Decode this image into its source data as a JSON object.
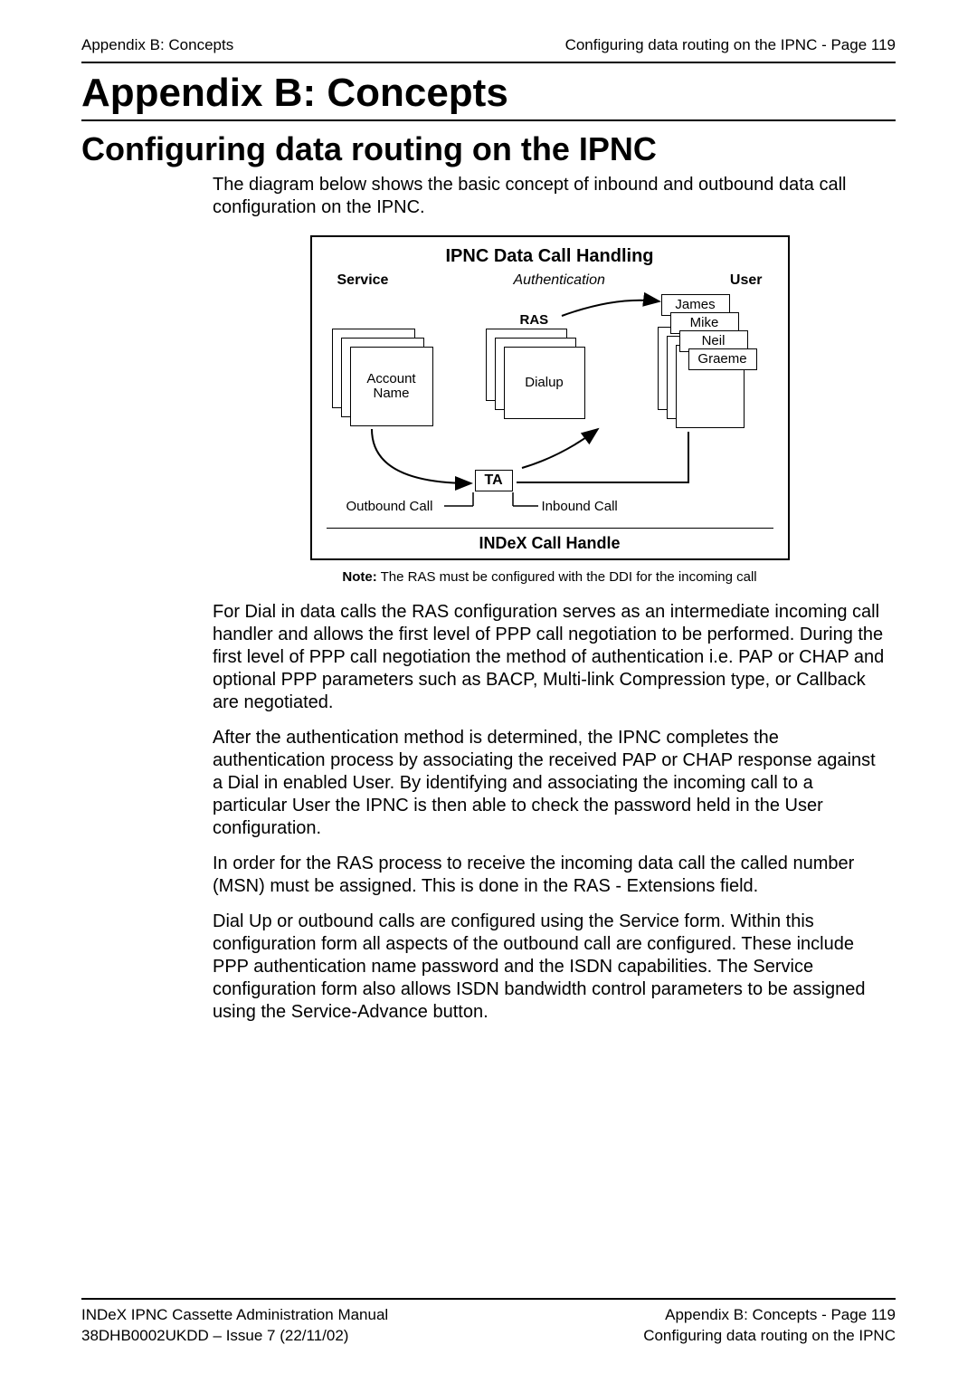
{
  "header": {
    "left": "Appendix B: Concepts",
    "right": "Configuring data routing on the IPNC - Page 119"
  },
  "title": "Appendix B: Concepts",
  "section_title": "Configuring data routing on the IPNC",
  "intro": "The diagram below shows the basic concept of inbound and outbound data call configuration on the IPNC.",
  "diagram": {
    "title": "IPNC Data Call Handling",
    "top_labels": {
      "service": "Service",
      "auth": "Authentication",
      "user": "User"
    },
    "ras": "RAS",
    "account_box": "Account\nName",
    "dialup_box": "Dialup",
    "users": [
      "James",
      "Mike",
      "Neil",
      "Graeme"
    ],
    "ta": "TA",
    "outbound": "Outbound Call",
    "inbound": "Inbound Call",
    "handle": "INDeX Call Handle"
  },
  "note_label": "Note:",
  "note_text": " The RAS must be configured with the DDI for the incoming call",
  "paragraphs": [
    "For Dial in data calls the RAS configuration serves as an intermediate incoming call handler and allows the first level of PPP call negotiation to be performed. During the first level of PPP call negotiation the method of authentication i.e. PAP or CHAP and optional PPP parameters such as BACP, Multi-link Compression type, or Callback are negotiated.",
    "After the authentication method is determined, the IPNC completes the authentication process by associating the received PAP or CHAP response against a Dial in enabled User. By identifying and associating the incoming call to a particular User the IPNC is then able to check the password held in the User configuration.",
    "In order for the RAS process to receive the incoming data call the called number (MSN) must be assigned. This is done in the RAS - Extensions field.",
    "Dial Up or outbound calls are configured using the Service form. Within this configuration form all aspects of the outbound call are configured. These include PPP authentication name password and the ISDN capabilities. The Service configuration form also allows ISDN bandwidth control parameters to be assigned using the Service-Advance button."
  ],
  "footer": {
    "left1": "INDeX IPNC Cassette Administration Manual",
    "left2": "38DHB0002UKDD – Issue 7 (22/11/02)",
    "right1": "Appendix B: Concepts - Page 119",
    "right2": "Configuring data routing on the IPNC"
  }
}
